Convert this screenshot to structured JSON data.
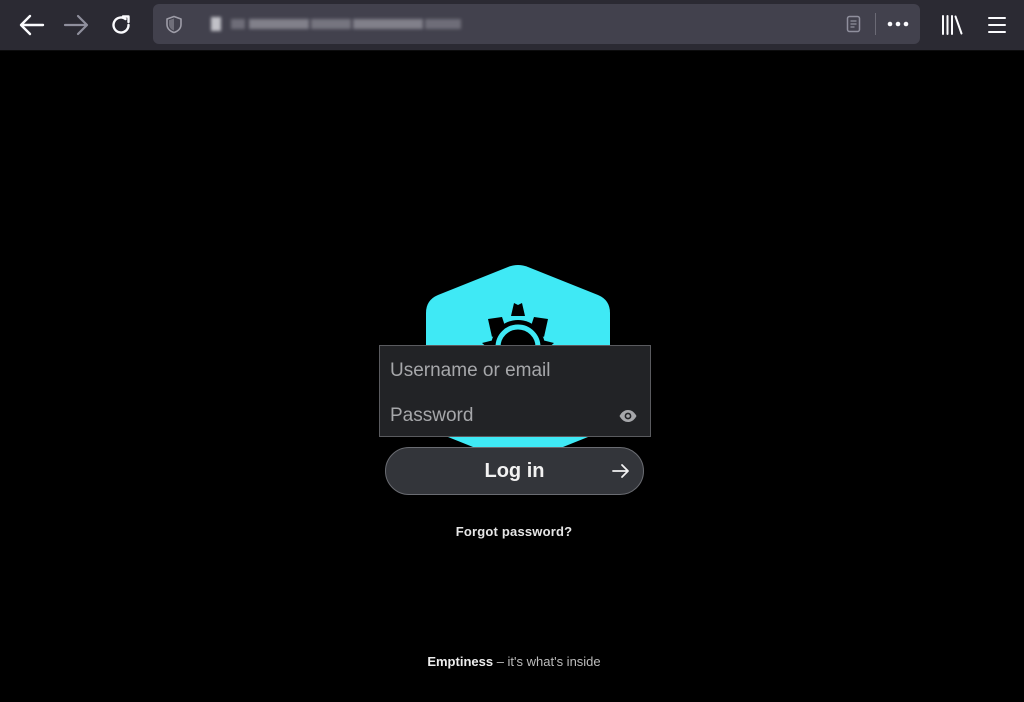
{
  "browser": {
    "back_icon": "arrow-left-icon",
    "forward_icon": "arrow-right-icon",
    "reload_icon": "reload-icon",
    "tracking_icon": "shield-icon",
    "reader_icon": "reader-view-icon",
    "actions_icon": "ellipsis-icon",
    "library_icon": "library-icon",
    "menu_icon": "hamburger-menu-icon"
  },
  "logo": {
    "icon": "sun-hexagon-logo",
    "color": "#3fe9f5"
  },
  "login": {
    "username_placeholder": "Username or email",
    "password_placeholder": "Password",
    "show_password_icon": "eye-icon",
    "submit_label": "Log in",
    "submit_icon": "arrow-right-icon",
    "forgot_password": "Forgot password?"
  },
  "footer": {
    "brand": "Emptiness",
    "tagline": " – it's what's inside"
  }
}
